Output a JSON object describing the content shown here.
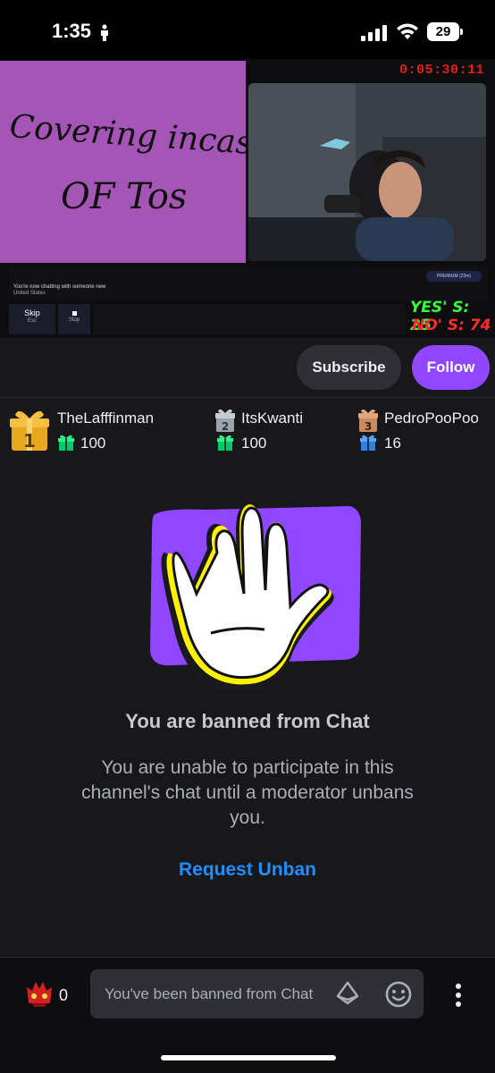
{
  "status_bar": {
    "time": "1:35",
    "battery": "29"
  },
  "video": {
    "whiteboard_text_line1": "Covering incase",
    "whiteboard_text_line2": "OF Tos",
    "timer": "0:05:30:11",
    "chat_notice": "You're now chatting with someone new",
    "location": "United States",
    "premium_badge": "PREMIUM (23m)",
    "skip_label": "Skip",
    "skip_sub": "Esc",
    "stop_label": "Stop",
    "yes_label": "YES' S: 25",
    "no_label": "NO' S: 74"
  },
  "actions": {
    "subscribe": "Subscribe",
    "follow": "Follow"
  },
  "gifters": [
    {
      "rank": "1",
      "name": "TheLafffinman",
      "count": "100"
    },
    {
      "rank": "2",
      "name": "ItsKwanti",
      "count": "100"
    },
    {
      "rank": "3",
      "name": "PedroPooPoo",
      "count": "16"
    }
  ],
  "ban": {
    "title": "You are banned from Chat",
    "message": "You are unable to participate in this channel's chat until a moderator unbans you.",
    "request_unban": "Request Unban"
  },
  "bottom": {
    "points": "0",
    "placeholder": "You've been banned from Chat"
  },
  "colors": {
    "accent": "#9147ff",
    "link": "#1f8fff",
    "background": "#18181b"
  }
}
